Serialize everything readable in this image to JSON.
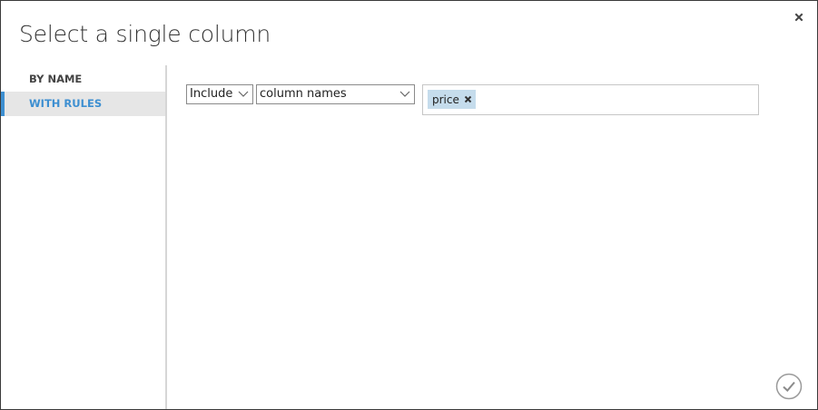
{
  "dialog": {
    "title": "Select a single column",
    "close_icon": "close-icon",
    "confirm_icon": "checkmark-icon"
  },
  "sidebar": {
    "items": [
      {
        "label": "BY NAME",
        "active": false
      },
      {
        "label": "WITH RULES",
        "active": true
      }
    ],
    "active_color": "#3d8fd1"
  },
  "rule": {
    "mode": {
      "value": "Include",
      "icon": "chevron-down-icon"
    },
    "type": {
      "value": "column names",
      "icon": "chevron-down-icon"
    },
    "tags": [
      {
        "label": "price",
        "remove_icon": "remove-tag-icon"
      }
    ],
    "tag_color": "#c5dcec"
  }
}
